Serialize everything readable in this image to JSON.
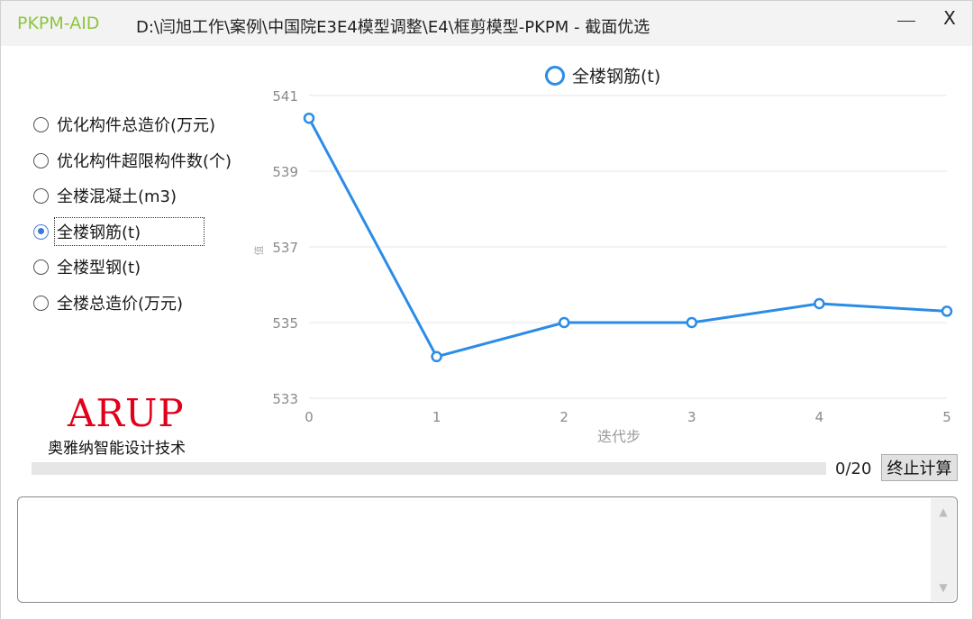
{
  "window": {
    "app_name": "PKPM-AID",
    "title": "D:\\闫旭工作\\案例\\中国院E3E4模型调整\\E4\\框剪模型-PKPM - 截面优选",
    "minimize_icon": "minimize-icon",
    "close_label": "X"
  },
  "options": {
    "items": [
      {
        "label": "优化构件总造价(万元)",
        "selected": false
      },
      {
        "label": "优化构件超限构件数(个)",
        "selected": false
      },
      {
        "label": "全楼混凝土(m3)",
        "selected": false
      },
      {
        "label": "全楼钢筋(t)",
        "selected": true
      },
      {
        "label": "全楼型钢(t)",
        "selected": false
      },
      {
        "label": "全楼总造价(万元)",
        "selected": false
      }
    ]
  },
  "logo": {
    "text": "ARUP",
    "subtitle": "奥雅纳智能设计技术",
    "color": "#e1001a"
  },
  "chart_data": {
    "type": "line",
    "legend": "全楼钢筋(t)",
    "legend_position": "top-center",
    "x": [
      0,
      1,
      2,
      3,
      4,
      5
    ],
    "series": [
      {
        "name": "全楼钢筋(t)",
        "values": [
          540.4,
          534.1,
          535.0,
          535.0,
          535.5,
          535.3
        ]
      }
    ],
    "xlabel": "迭代步",
    "ylabel": "值",
    "ylim": [
      533,
      541
    ],
    "yticks": [
      "541",
      "539",
      "537",
      "535",
      "533"
    ],
    "xticks": [
      "0",
      "1",
      "2",
      "3",
      "4",
      "5"
    ],
    "grid": true,
    "color": "#2b8ce6"
  },
  "progress": {
    "value": 0,
    "text": "0/20"
  },
  "stop_button": {
    "label": "终止计算"
  },
  "log": {
    "text": ""
  }
}
